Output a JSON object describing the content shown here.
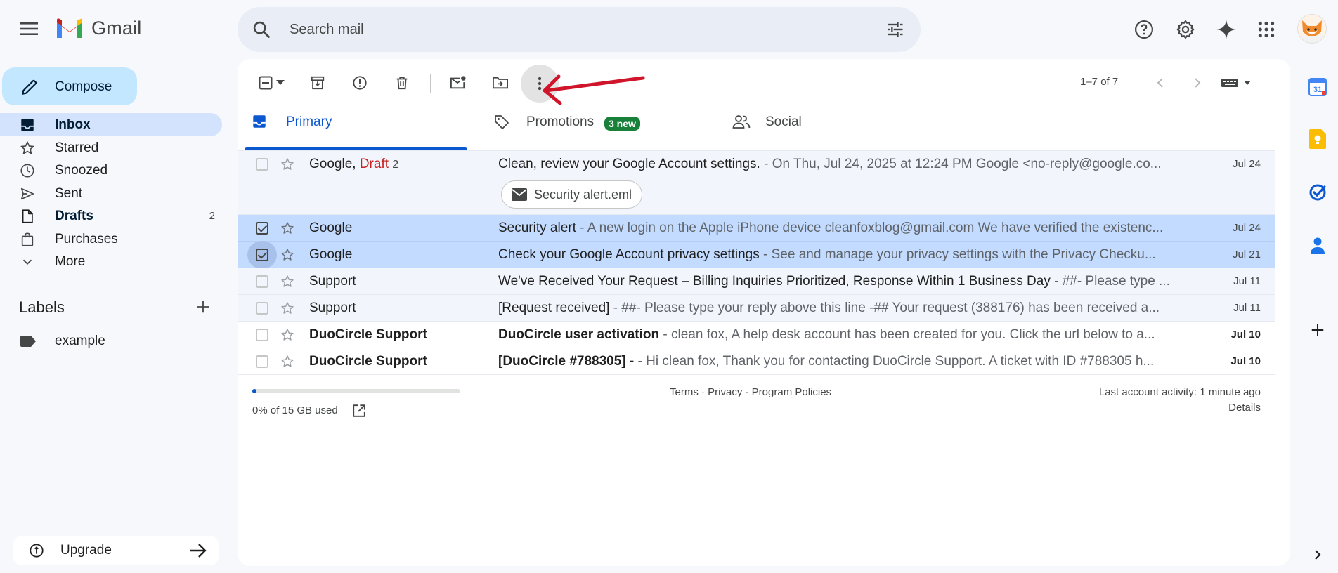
{
  "app": {
    "name": "Gmail"
  },
  "search": {
    "placeholder": "Search mail"
  },
  "compose": {
    "label": "Compose"
  },
  "nav": [
    {
      "label": "Inbox",
      "icon": "inbox-icon",
      "count": "",
      "active": true
    },
    {
      "label": "Starred",
      "icon": "star-icon",
      "count": ""
    },
    {
      "label": "Snoozed",
      "icon": "clock-icon",
      "count": ""
    },
    {
      "label": "Sent",
      "icon": "send-icon",
      "count": ""
    },
    {
      "label": "Drafts",
      "icon": "file-icon",
      "count": "2",
      "bold": true
    },
    {
      "label": "Purchases",
      "icon": "shopping-bag-icon",
      "count": ""
    },
    {
      "label": "More",
      "icon": "chevron-down-icon",
      "count": ""
    }
  ],
  "labels": {
    "heading": "Labels",
    "items": [
      {
        "label": "example"
      }
    ]
  },
  "upgrade": {
    "label": "Upgrade"
  },
  "toolbar": {
    "pagination": "1–7 of 7"
  },
  "tabs": {
    "primary": "Primary",
    "promotions": "Promotions",
    "promotions_badge": "3 new",
    "social": "Social"
  },
  "emails": [
    {
      "sender": "Google, ",
      "draft": "Draft",
      "count": "2",
      "subject": "Clean, review your Google Account settings.",
      "snippet": " - On Thu, Jul 24, 2025 at 12:24 PM Google <no-reply@google.co...",
      "date": "Jul 24",
      "attachment": "Security alert.eml",
      "state": "read",
      "checked": false
    },
    {
      "sender": "Google",
      "subject": "Security alert",
      "snippet": " - A new login on the Apple iPhone device cleanfoxblog@gmail.com We have verified the existenc...",
      "date": "Jul 24",
      "state": "selected",
      "checked": true
    },
    {
      "sender": "Google",
      "subject": "Check your Google Account privacy settings",
      "snippet": " - See and manage your privacy settings with the Privacy Checku...",
      "date": "Jul 21",
      "state": "selected",
      "checked": true
    },
    {
      "sender": "Support",
      "subject": "We've Received Your Request – Billing Inquiries Prioritized, Response Within 1 Business Day",
      "snippet": " - ##- Please type ...",
      "date": "Jul 11",
      "state": "read",
      "checked": false
    },
    {
      "sender": "Support",
      "subject": "[Request received]",
      "snippet": " - ##- Please type your reply above this line -## Your request (388176) has been received a...",
      "date": "Jul 11",
      "state": "read",
      "checked": false
    },
    {
      "sender": "DuoCircle Support",
      "subject": "DuoCircle user activation",
      "snippet": " - clean fox, A help desk account has been created for you. Click the url below to a...",
      "date": "Jul 10",
      "state": "unread",
      "checked": false
    },
    {
      "sender": "DuoCircle Support",
      "subject": "[DuoCircle #788305] -",
      "snippet": " - Hi clean fox, Thank you for contacting DuoCircle Support. A ticket with ID #788305 h...",
      "date": "Jul 10",
      "state": "unread",
      "checked": false
    }
  ],
  "footer": {
    "storage": "0% of 15 GB used",
    "storage_fraction": 0.02,
    "links": "Terms · Privacy · Program Policies",
    "activity": "Last account activity: 1 minute ago",
    "details": "Details"
  },
  "colors": {
    "accent": "#0b57d0",
    "compose_bg": "#c2e7ff",
    "active_nav": "#d3e3fd",
    "badge": "#188038",
    "annotation_arrow": "#d0142a"
  }
}
